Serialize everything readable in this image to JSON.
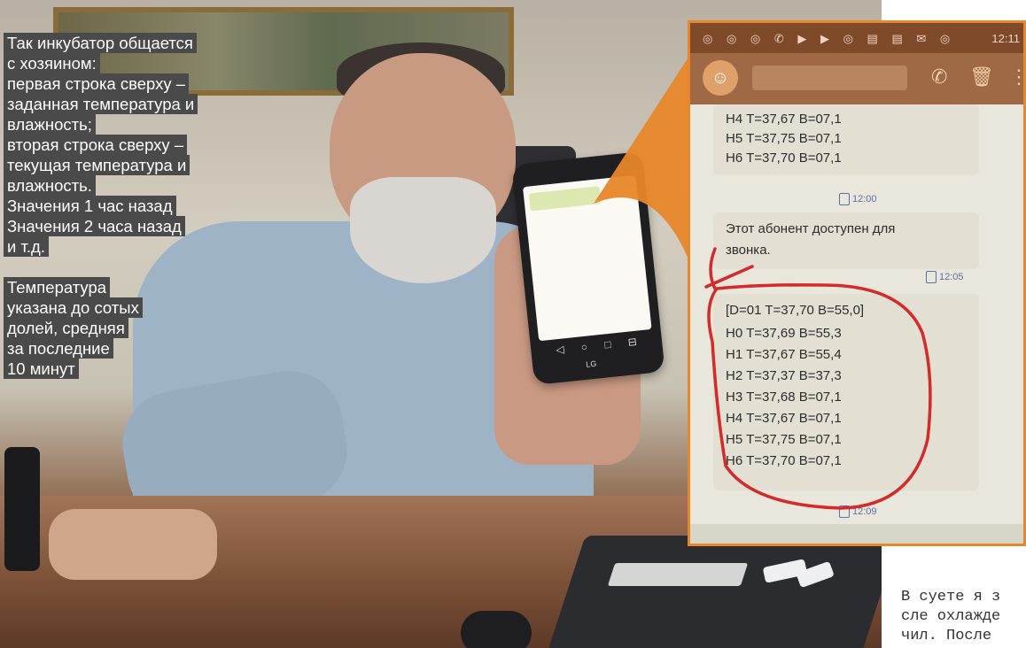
{
  "caption": {
    "lines": [
      "Так инкубатор общается",
      "с хозяином:",
      "первая строка сверху –",
      "заданная температура и",
      "влажность;",
      "вторая строка сверху –",
      "текущая температура и",
      "влажность.",
      "Значения 1 час назад",
      "Значения 2 часа назад",
      "и т.д.",
      "",
      "Температура",
      "указана до сотых",
      "долей, средняя",
      "за последние",
      "10 минут"
    ]
  },
  "phone": {
    "brand": "LG",
    "nav": "◁ ○ □ ⊟"
  },
  "inset": {
    "status_time": "12:11",
    "status_icons": "◎ ◎ ◎ ✆ ▶ ▶ ◎ ▤ ▤ ✉ ◎",
    "avatar_icon": "person-icon",
    "message1_lines": [
      "H4 T=37,67 B=07,1",
      "H5 T=37,75 B=07,1",
      "H6 T=37,70 B=07,1"
    ],
    "time1": "12:00",
    "message2_lines": [
      "Этот абонент доступен для",
      "звонка."
    ],
    "time2": "12:05",
    "message3_lines": [
      "[D=01 T=37,70 B=55,0]",
      "H0 T=37,69 B=55,3",
      "H1 T=37,67 B=55,4",
      "H2 T=37,37 B=37,3",
      "H3 T=37,68 B=07,1",
      "H4 T=37,67 B=07,1",
      "H5 T=37,75 B=07,1",
      "H6 T=37,70 B=07,1"
    ],
    "time3": "12:09",
    "highlight_color": "#d42a2a",
    "frame_color": "#e8872a"
  },
  "article": {
    "lines": [
      "В суете я з",
      "сле охлажде",
      "чил. После"
    ]
  }
}
